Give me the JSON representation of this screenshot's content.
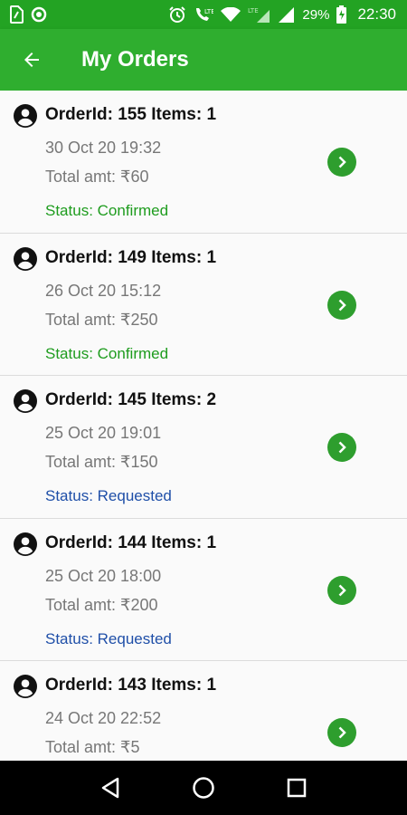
{
  "status_bar": {
    "time": "22:30",
    "battery_percent": "29%",
    "lte_label": "LTE",
    "icons": [
      "sim-icon",
      "circle-notification-icon",
      "alarm-icon",
      "volte-icon",
      "wifi-icon",
      "lte-signal-icon",
      "signal-icon",
      "battery-charging-icon"
    ]
  },
  "app_bar": {
    "title": "My Orders",
    "back_icon": "back-arrow-icon"
  },
  "colors": {
    "status_bar": "#23a323",
    "app_bar": "#2fae2f",
    "confirmed": "#1e9c1e",
    "requested": "#1f4fa8",
    "chevron_button": "#2e9e2e"
  },
  "orders": [
    {
      "title": "OrderId: 155 Items: 1",
      "date": "30 Oct 20 19:32",
      "amount": "Total amt: ₹60",
      "status": "Status: Confirmed",
      "status_type": "confirmed"
    },
    {
      "title": "OrderId: 149 Items: 1",
      "date": "26 Oct 20 15:12",
      "amount": "Total amt: ₹250",
      "status": "Status: Confirmed",
      "status_type": "confirmed"
    },
    {
      "title": "OrderId: 145 Items: 2",
      "date": "25 Oct 20 19:01",
      "amount": "Total amt: ₹150",
      "status": "Status: Requested",
      "status_type": "requested"
    },
    {
      "title": "OrderId: 144 Items: 1",
      "date": "25 Oct 20 18:00",
      "amount": "Total amt: ₹200",
      "status": "Status: Requested",
      "status_type": "requested"
    },
    {
      "title": "OrderId: 143 Items: 1",
      "date": "24 Oct 20 22:52",
      "amount": "Total amt: ₹5",
      "status": "",
      "status_type": ""
    }
  ],
  "nav_bar": {
    "buttons": [
      "back-triangle-icon",
      "home-circle-icon",
      "recents-square-icon"
    ]
  }
}
